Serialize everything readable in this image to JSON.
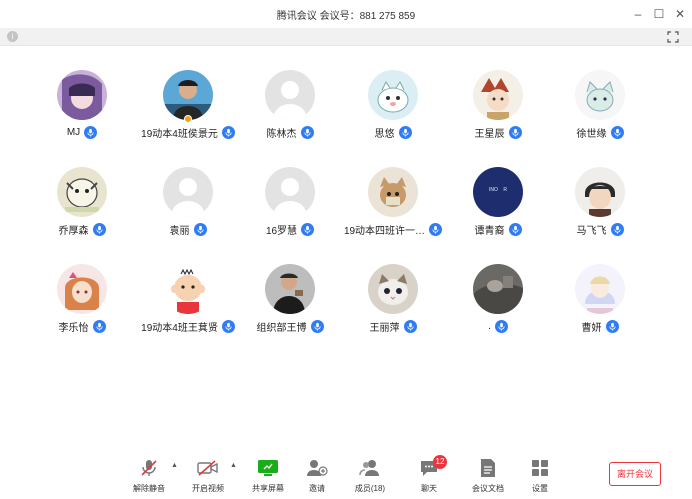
{
  "window": {
    "title": "腾讯会议  会议号：881 275 859",
    "minimize_glyph": "–",
    "maximize_glyph": "☐",
    "close_glyph": "✕"
  },
  "subbar": {
    "info_glyph": "i"
  },
  "participants": [
    {
      "name": "MJ",
      "avatar": "anime-purple"
    },
    {
      "name": "19动本4班侯景元",
      "avatar": "photo-man",
      "host": true
    },
    {
      "name": "陈林杰",
      "avatar": "default"
    },
    {
      "name": "思悠",
      "avatar": "cartoon-cat"
    },
    {
      "name": "王星辰",
      "avatar": "anime-fox"
    },
    {
      "name": "徐世缘",
      "avatar": "cartoon-kitten"
    },
    {
      "name": "乔厚森",
      "avatar": "meme-dog"
    },
    {
      "name": "袁丽",
      "avatar": "default"
    },
    {
      "name": "16罗慧",
      "avatar": "default"
    },
    {
      "name": "19动本四班许一…",
      "avatar": "photo-cat"
    },
    {
      "name": "谭青裔",
      "avatar": "navy-logo",
      "avatar_text": "INO    R"
    },
    {
      "name": "马飞飞",
      "avatar": "anime-boy"
    },
    {
      "name": "李乐怡",
      "avatar": "anime-girl"
    },
    {
      "name": "19动本4班王萁贤",
      "avatar": "cartoon-baby"
    },
    {
      "name": "组织部王博",
      "avatar": "photo-person"
    },
    {
      "name": "王丽萍",
      "avatar": "photo-kitten"
    },
    {
      "name": ".",
      "avatar": "photo-dark"
    },
    {
      "name": "曹妍",
      "avatar": "anime-pastel"
    }
  ],
  "toolbar": {
    "unmute": "解除静音",
    "start_video": "开启视频",
    "share_screen": "共享屏幕",
    "invite": "邀请",
    "members": "成员(18)",
    "chat": "聊天",
    "chat_badge": "12",
    "docs": "会议文档",
    "settings": "设置",
    "leave": "离开会议",
    "caret": "▲"
  },
  "colors": {
    "accent": "#2f7df6",
    "danger": "#e8363c",
    "share_green": "#1aad19"
  }
}
